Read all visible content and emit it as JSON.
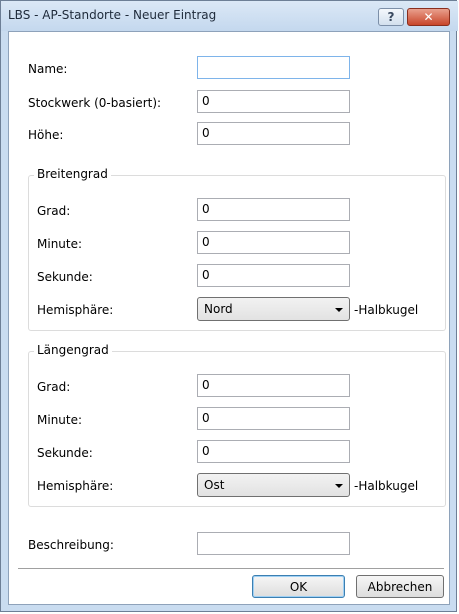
{
  "window": {
    "title": "LBS - AP-Standorte - Neuer Eintrag",
    "help_label": "?",
    "close_label": "✕"
  },
  "form": {
    "name_label": "Name:",
    "name_value": "",
    "floor_label": "Stockwerk (0-basiert):",
    "floor_value": "0",
    "height_label": "Höhe:",
    "height_value": "0",
    "latitude": {
      "legend": "Breitengrad",
      "degree_label": "Grad:",
      "degree_value": "0",
      "minute_label": "Minute:",
      "minute_value": "0",
      "second_label": "Sekunde:",
      "second_value": "0",
      "hemisphere_label": "Hemisphäre:",
      "hemisphere_value": "Nord",
      "hemisphere_suffix": "-Halbkugel"
    },
    "longitude": {
      "legend": "Längengrad",
      "degree_label": "Grad:",
      "degree_value": "0",
      "minute_label": "Minute:",
      "minute_value": "0",
      "second_label": "Sekunde:",
      "second_value": "0",
      "hemisphere_label": "Hemisphäre:",
      "hemisphere_value": "Ost",
      "hemisphere_suffix": "-Halbkugel"
    },
    "description_label": "Beschreibung:",
    "description_value": ""
  },
  "buttons": {
    "ok": "OK",
    "cancel": "Abbrechen"
  }
}
